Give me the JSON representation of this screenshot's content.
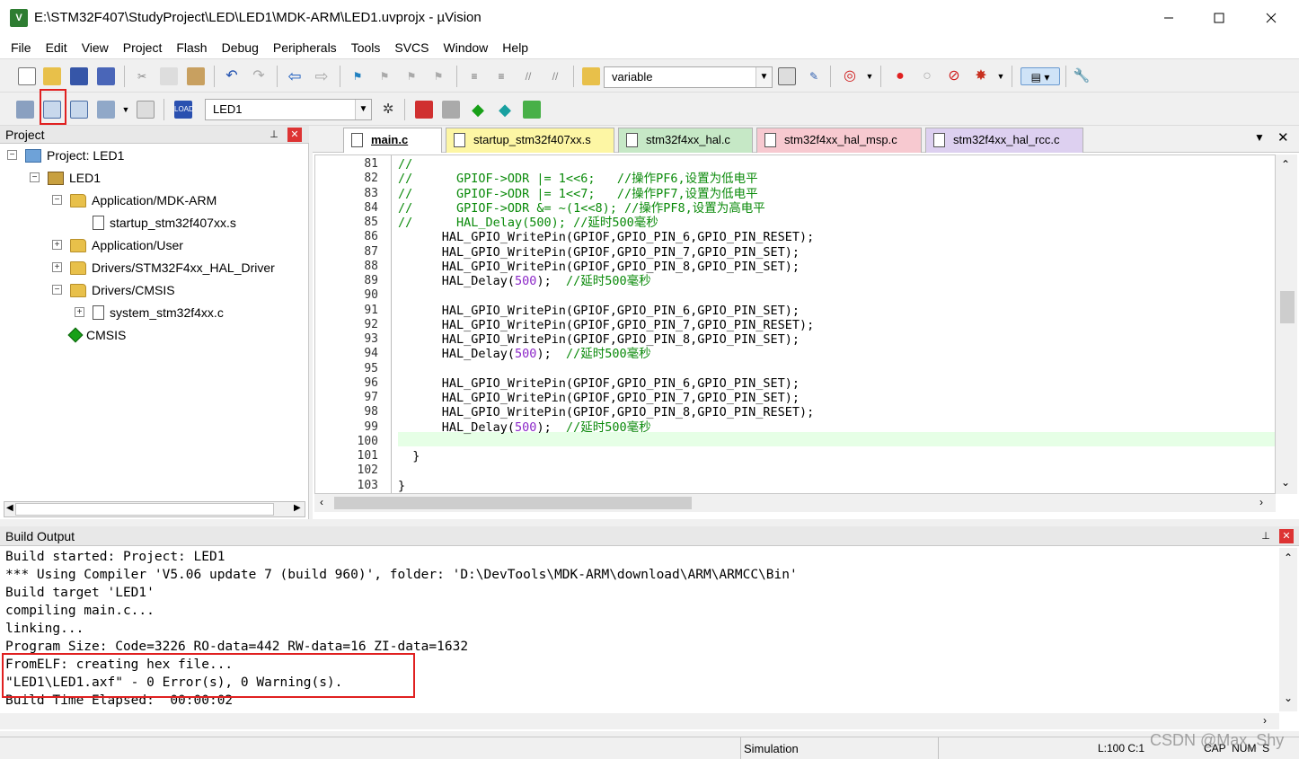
{
  "window": {
    "title": "E:\\STM32F407\\StudyProject\\LED\\LED1\\MDK-ARM\\LED1.uvprojx - µVision",
    "app_icon_label": "V"
  },
  "menu": [
    "File",
    "Edit",
    "View",
    "Project",
    "Flash",
    "Debug",
    "Peripherals",
    "Tools",
    "SVCS",
    "Window",
    "Help"
  ],
  "toolbar": {
    "find_combo": "variable",
    "target_combo": "LED1"
  },
  "project_panel": {
    "title": "Project",
    "tree": [
      {
        "label": "Project: LED1",
        "level": 0,
        "toggle": "-",
        "icon": "project-icon"
      },
      {
        "label": "LED1",
        "level": 1,
        "toggle": "-",
        "icon": "target-icon"
      },
      {
        "label": "Application/MDK-ARM",
        "level": 2,
        "toggle": "-",
        "icon": "folder-icon"
      },
      {
        "label": "startup_stm32f407xx.s",
        "level": 3,
        "toggle": "",
        "icon": "file-icon"
      },
      {
        "label": "Application/User",
        "level": 2,
        "toggle": "+",
        "icon": "folder-icon"
      },
      {
        "label": "Drivers/STM32F4xx_HAL_Driver",
        "level": 2,
        "toggle": "+",
        "icon": "folder-icon"
      },
      {
        "label": "Drivers/CMSIS",
        "level": 2,
        "toggle": "-",
        "icon": "folder-icon"
      },
      {
        "label": "system_stm32f4xx.c",
        "level": 3,
        "toggle": "+",
        "icon": "file-icon"
      },
      {
        "label": "CMSIS",
        "level": 2,
        "toggle": "",
        "icon": "cmsis-icon"
      }
    ]
  },
  "editor": {
    "tabs": [
      {
        "label": "main.c",
        "color": "#ffffff",
        "active": true
      },
      {
        "label": "startup_stm32f407xx.s",
        "color": "#fdf6a4"
      },
      {
        "label": "stm32f4xx_hal.c",
        "color": "#c6e8c6"
      },
      {
        "label": "stm32f4xx_hal_msp.c",
        "color": "#f7c9d0"
      },
      {
        "label": "stm32f4xx_hal_rcc.c",
        "color": "#ddd0f0"
      }
    ],
    "lines": [
      {
        "n": "81",
        "code": [
          {
            "t": "//",
            "c": "cm"
          }
        ]
      },
      {
        "n": "82",
        "code": [
          {
            "t": "//      GPIOF->ODR |= 1<<6;   //操作PF6,设置为低电平",
            "c": "cm"
          }
        ]
      },
      {
        "n": "83",
        "code": [
          {
            "t": "//      GPIOF->ODR |= 1<<7;   //操作PF7,设置为低电平",
            "c": "cm"
          }
        ]
      },
      {
        "n": "84",
        "code": [
          {
            "t": "//      GPIOF->ODR &= ~(1<<8); //操作PF8,设置为高电平",
            "c": "cm"
          }
        ]
      },
      {
        "n": "85",
        "code": [
          {
            "t": "//      HAL_Delay(500); //延时500毫秒",
            "c": "cm"
          }
        ]
      },
      {
        "n": "86",
        "code": [
          {
            "t": "      HAL_GPIO_WritePin(GPIOF,GPIO_PIN_6,GPIO_PIN_RESET);",
            "c": ""
          }
        ]
      },
      {
        "n": "87",
        "code": [
          {
            "t": "      HAL_GPIO_WritePin(GPIOF,GPIO_PIN_7,GPIO_PIN_SET);",
            "c": ""
          }
        ]
      },
      {
        "n": "88",
        "code": [
          {
            "t": "      HAL_GPIO_WritePin(GPIOF,GPIO_PIN_8,GPIO_PIN_SET);",
            "c": ""
          }
        ]
      },
      {
        "n": "89",
        "code": [
          {
            "t": "      HAL_Delay(",
            "c": ""
          },
          {
            "t": "500",
            "c": "num"
          },
          {
            "t": ");  ",
            "c": ""
          },
          {
            "t": "//延时500毫秒",
            "c": "cm"
          }
        ]
      },
      {
        "n": "90",
        "code": []
      },
      {
        "n": "91",
        "code": [
          {
            "t": "      HAL_GPIO_WritePin(GPIOF,GPIO_PIN_6,GPIO_PIN_SET);",
            "c": ""
          }
        ]
      },
      {
        "n": "92",
        "code": [
          {
            "t": "      HAL_GPIO_WritePin(GPIOF,GPIO_PIN_7,GPIO_PIN_RESET);",
            "c": ""
          }
        ]
      },
      {
        "n": "93",
        "code": [
          {
            "t": "      HAL_GPIO_WritePin(GPIOF,GPIO_PIN_8,GPIO_PIN_SET);",
            "c": ""
          }
        ]
      },
      {
        "n": "94",
        "code": [
          {
            "t": "      HAL_Delay(",
            "c": ""
          },
          {
            "t": "500",
            "c": "num"
          },
          {
            "t": ");  ",
            "c": ""
          },
          {
            "t": "//延时500毫秒",
            "c": "cm"
          }
        ]
      },
      {
        "n": "95",
        "code": []
      },
      {
        "n": "96",
        "code": [
          {
            "t": "      HAL_GPIO_WritePin(GPIOF,GPIO_PIN_6,GPIO_PIN_SET);",
            "c": ""
          }
        ]
      },
      {
        "n": "97",
        "code": [
          {
            "t": "      HAL_GPIO_WritePin(GPIOF,GPIO_PIN_7,GPIO_PIN_SET);",
            "c": ""
          }
        ]
      },
      {
        "n": "98",
        "code": [
          {
            "t": "      HAL_GPIO_WritePin(GPIOF,GPIO_PIN_8,GPIO_PIN_RESET);",
            "c": ""
          }
        ]
      },
      {
        "n": "99",
        "code": [
          {
            "t": "      HAL_Delay(",
            "c": ""
          },
          {
            "t": "500",
            "c": "num"
          },
          {
            "t": ");  ",
            "c": ""
          },
          {
            "t": "//延时500毫秒",
            "c": "cm"
          }
        ]
      },
      {
        "n": "100",
        "code": []
      },
      {
        "n": "101",
        "code": [
          {
            "t": "  }",
            "c": ""
          }
        ]
      },
      {
        "n": "102",
        "code": []
      },
      {
        "n": "103",
        "code": [
          {
            "t": "}",
            "c": ""
          }
        ]
      }
    ]
  },
  "build_output": {
    "title": "Build Output",
    "lines": [
      "Build started: Project: LED1",
      "*** Using Compiler 'V5.06 update 7 (build 960)', folder: 'D:\\DevTools\\MDK-ARM\\download\\ARM\\ARMCC\\Bin'",
      "Build target 'LED1'",
      "compiling main.c...",
      "linking...",
      "Program Size: Code=3226 RO-data=442 RW-data=16 ZI-data=1632",
      "FromELF: creating hex file...",
      "\"LED1\\LED1.axf\" - 0 Error(s), 0 Warning(s).",
      "Build Time Elapsed:  00:00:02"
    ]
  },
  "status": {
    "mode": "Simulation",
    "position": "L:100 C:1",
    "keys": "CAP  NUM  S",
    "watermark": "CSDN @Max_Shy"
  }
}
